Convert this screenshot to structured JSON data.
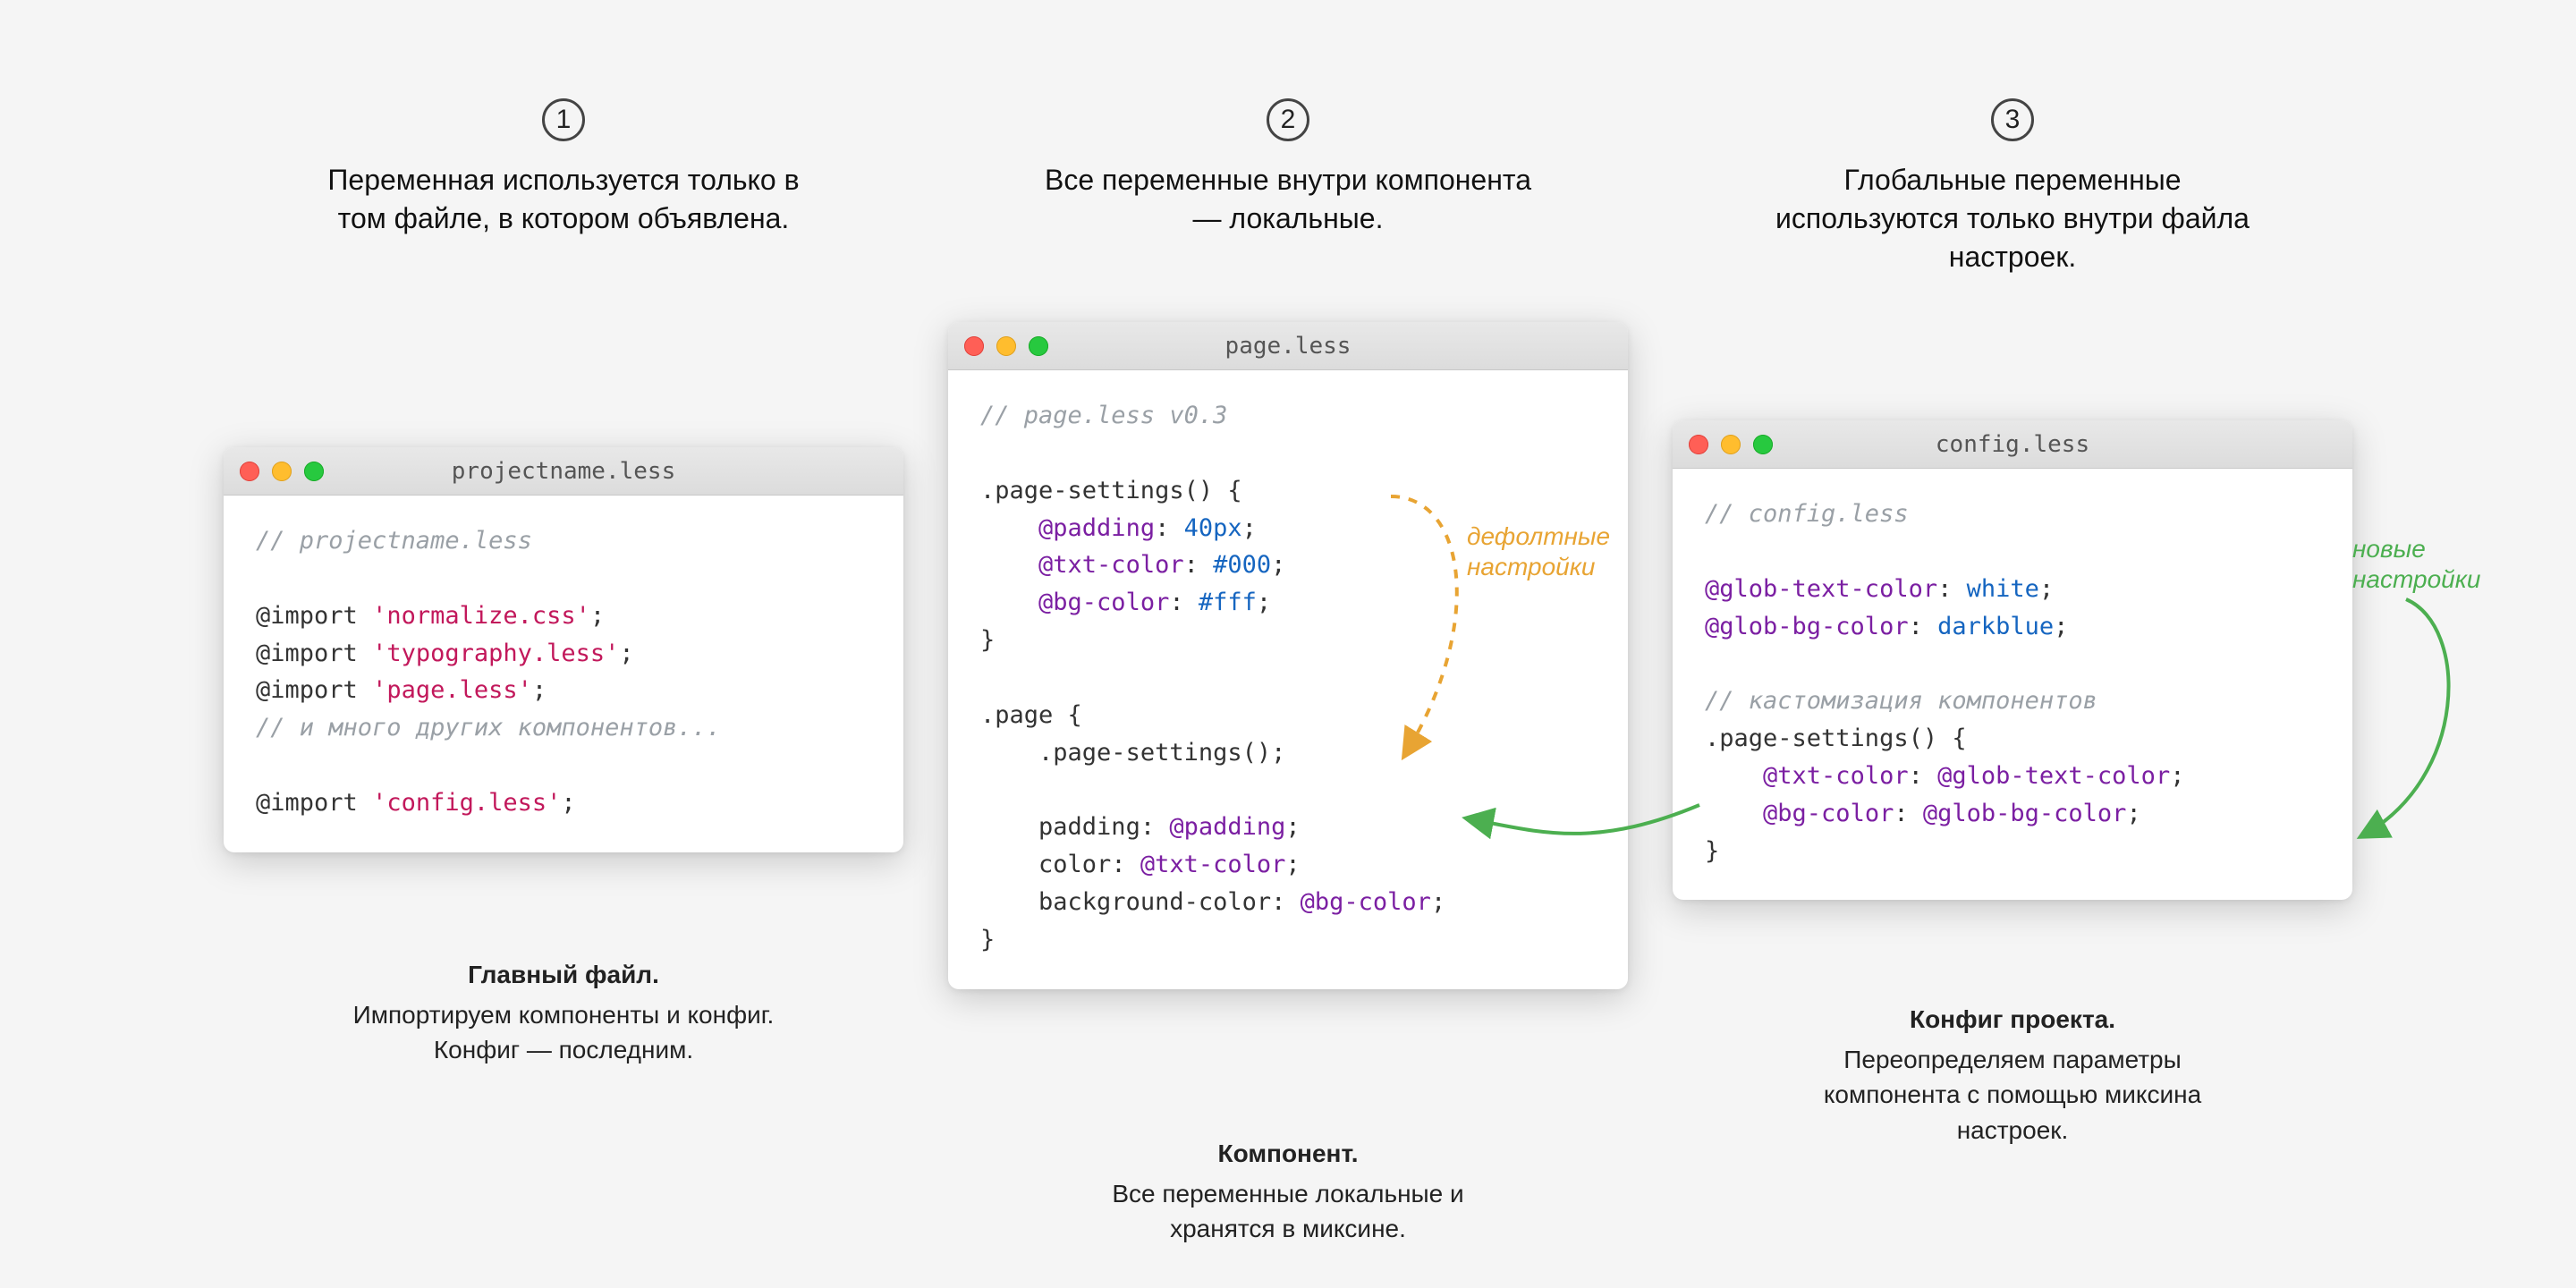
{
  "steps": [
    {
      "num": "1",
      "text": "Переменная используется только в том файле, в котором объявлена."
    },
    {
      "num": "2",
      "text": "Все переменные внутри компонента — локальные."
    },
    {
      "num": "3",
      "text": "Глобальные переменные используются только внутри файла настроек."
    }
  ],
  "windows": {
    "w1": {
      "title": "projectname.less",
      "lines": {
        "comment1": "// projectname.less",
        "import_kw": "@import",
        "import1": "'normalize.css'",
        "import2": "'typography.less'",
        "import3": "'page.less'",
        "comment2": "// и много других компонентов...",
        "import4": "'config.less'"
      }
    },
    "w2": {
      "title": "page.less",
      "lines": {
        "comment1": "// page.less v0.3",
        "mixin_def": ".page-settings() {",
        "var1_name": "@padding",
        "var1_val": "40px",
        "var2_name": "@txt-color",
        "var2_val": "#000",
        "var3_name": "@bg-color",
        "var3_val": "#fff",
        "close1": "}",
        "selector": ".page {",
        "mixin_call": ".page-settings();",
        "prop1": "padding",
        "pval1": "@padding",
        "prop2": "color",
        "pval2": "@txt-color",
        "prop3": "background-color",
        "pval3": "@bg-color",
        "close2": "}"
      }
    },
    "w3": {
      "title": "config.less",
      "lines": {
        "comment1": "// config.less",
        "gvar1_name": "@glob-text-color",
        "gvar1_val": "white",
        "gvar2_name": "@glob-bg-color",
        "gvar2_val": "darkblue",
        "comment2": "// кастомизация компонентов",
        "mixin_def": ".page-settings() {",
        "ovar1_name": "@txt-color",
        "ovar1_val": "@glob-text-color",
        "ovar2_name": "@bg-color",
        "ovar2_val": "@glob-bg-color",
        "close": "}"
      }
    }
  },
  "captions": {
    "c1_title": "Главный файл.",
    "c1_body1": "Импортируем компоненты и конфиг.",
    "c1_body2": "Конфиг — последним.",
    "c2_title": "Компонент.",
    "c2_body1": "Все переменные локальные и",
    "c2_body2": "хранятся в миксине.",
    "c3_title": "Конфиг проекта.",
    "c3_body1": "Переопределяем параметры",
    "c3_body2": "компонента с помощью миксина",
    "c3_body3": "настроек."
  },
  "annotations": {
    "orange1": "дефолтные",
    "orange2": "настройки",
    "green1": "новые",
    "green2": "настройки"
  },
  "punct": {
    "semi": ";",
    "colon_sp": ": "
  }
}
